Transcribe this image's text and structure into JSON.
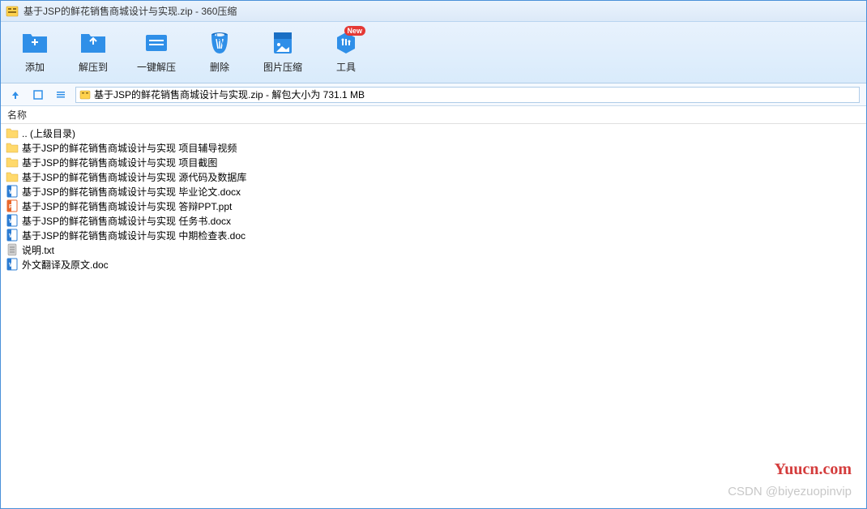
{
  "window": {
    "title": "基于JSP的鲜花销售商城设计与实现.zip - 360压缩"
  },
  "toolbar": {
    "add": "添加",
    "extract_to": "解压到",
    "one_click_extract": "一键解压",
    "delete": "删除",
    "image_compress": "图片压缩",
    "tools": "工具",
    "new_badge": "New"
  },
  "nav": {
    "path_text": "基于JSP的鲜花销售商城设计与实现.zip - 解包大小为 731.1 MB"
  },
  "columns": {
    "name": "名称"
  },
  "files": [
    {
      "icon": "folder",
      "name": ".. (上级目录)"
    },
    {
      "icon": "folder",
      "name": "基于JSP的鲜花销售商城设计与实现 项目辅导视频"
    },
    {
      "icon": "folder",
      "name": "基于JSP的鲜花销售商城设计与实现 项目截图"
    },
    {
      "icon": "folder",
      "name": "基于JSP的鲜花销售商城设计与实现 源代码及数据库"
    },
    {
      "icon": "docx",
      "name": "基于JSP的鲜花销售商城设计与实现 毕业论文.docx"
    },
    {
      "icon": "ppt",
      "name": "基于JSP的鲜花销售商城设计与实现 答辩PPT.ppt"
    },
    {
      "icon": "docx",
      "name": "基于JSP的鲜花销售商城设计与实现 任务书.docx"
    },
    {
      "icon": "docx",
      "name": "基于JSP的鲜花销售商城设计与实现 中期检查表.doc"
    },
    {
      "icon": "txt",
      "name": "说明.txt"
    },
    {
      "icon": "docx",
      "name": "外文翻译及原文.doc"
    }
  ],
  "watermark": {
    "site": "Yuucn.com",
    "csdn": "CSDN @biyezuopinvip"
  }
}
